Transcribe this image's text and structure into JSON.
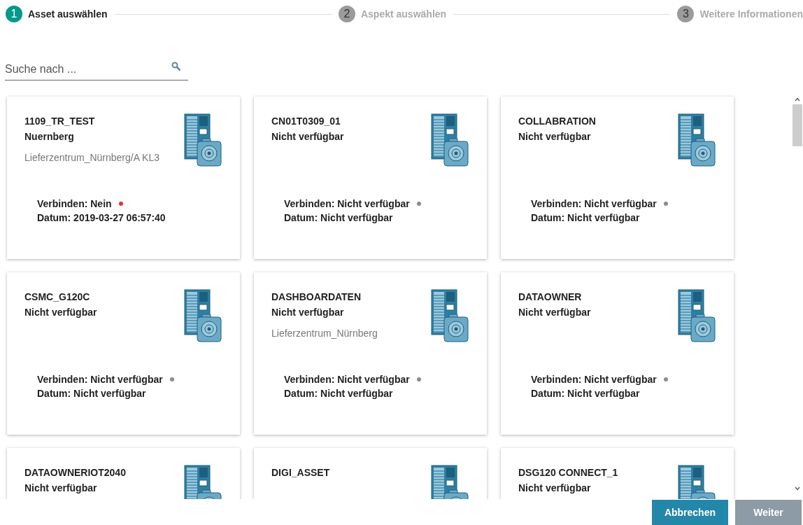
{
  "steps": [
    {
      "number": "1",
      "label": "Asset auswählen",
      "selected": true
    },
    {
      "number": "2",
      "label": "Aspekt auswählen",
      "selected": false
    },
    {
      "number": "3",
      "label": "Weitere Informationen",
      "selected": false
    }
  ],
  "search": {
    "placeholder": "Suche nach ..."
  },
  "assets": [
    {
      "name": "1109_TR_TEST",
      "location": "Nuernberg",
      "site": "Lieferzentrum_Nürnberg/A KL3",
      "connection": "Verbinden: Nein",
      "date": "Datum: 2019-03-27 06:57:40",
      "color": "#e8312f"
    },
    {
      "name": "CN01T0309_01",
      "location": "Nicht verfügbar",
      "connection": "Verbinden: Nicht verfügbar",
      "date": "Datum: Nicht verfügbar",
      "color": "#8c8c8c"
    },
    {
      "name": "COLLABRATION",
      "location": "Nicht verfügbar",
      "connection": "Verbinden: Nicht verfügbar",
      "date": "Datum: Nicht verfügbar",
      "color": "#8c8c8c"
    },
    {
      "name": "CSMC_G120C",
      "location": "Nicht verfügbar",
      "connection": "Verbinden: Nicht verfügbar",
      "date": "Datum: Nicht verfügbar",
      "color": "#8c8c8c"
    },
    {
      "name": "DASHBOARDATEN",
      "location": "Nicht verfügbar",
      "site": "Lieferzentrum_Nürnberg",
      "connection": "Verbinden: Nicht verfügbar",
      "date": "Datum: Nicht verfügbar",
      "color": "#8c8c8c"
    },
    {
      "name": "DATAOWNER",
      "location": "Nicht verfügbar",
      "connection": "Verbinden: Nicht verfügbar",
      "date": "Datum: Nicht verfügbar",
      "color": "#8c8c8c"
    },
    {
      "name": "DATAOWNERIOT2040",
      "location": "Nicht verfügbar"
    },
    {
      "name": "DIGI_ASSET"
    },
    {
      "name": "DSG120 CONNECT_1",
      "location": "Nicht verfügbar"
    }
  ],
  "buttons": [
    {
      "label": "Abbrechen",
      "disabled": false
    },
    {
      "label": "Weiter",
      "disabled": true
    }
  ]
}
